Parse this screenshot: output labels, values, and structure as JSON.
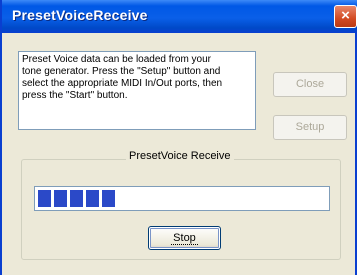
{
  "window": {
    "title": "PresetVoiceReceive",
    "close_glyph": "×"
  },
  "message": {
    "lines": [
      "Preset Voice data can be loaded from your",
      "tone generator. Press the \"Setup\" button and",
      "select the appropriate MIDI In/Out ports, then",
      "press the \"Start\" button."
    ]
  },
  "buttons": {
    "close_label": "Close",
    "setup_label": "Setup",
    "stop_label": "Stop"
  },
  "group": {
    "label": "PresetVoice Receive"
  },
  "progress": {
    "filled_segments": 5,
    "segment_color": "#2b49c8"
  },
  "colors": {
    "titlebar": "#0a5fe8",
    "close_button": "#d34a22",
    "dialog_background": "#ece9d8"
  }
}
